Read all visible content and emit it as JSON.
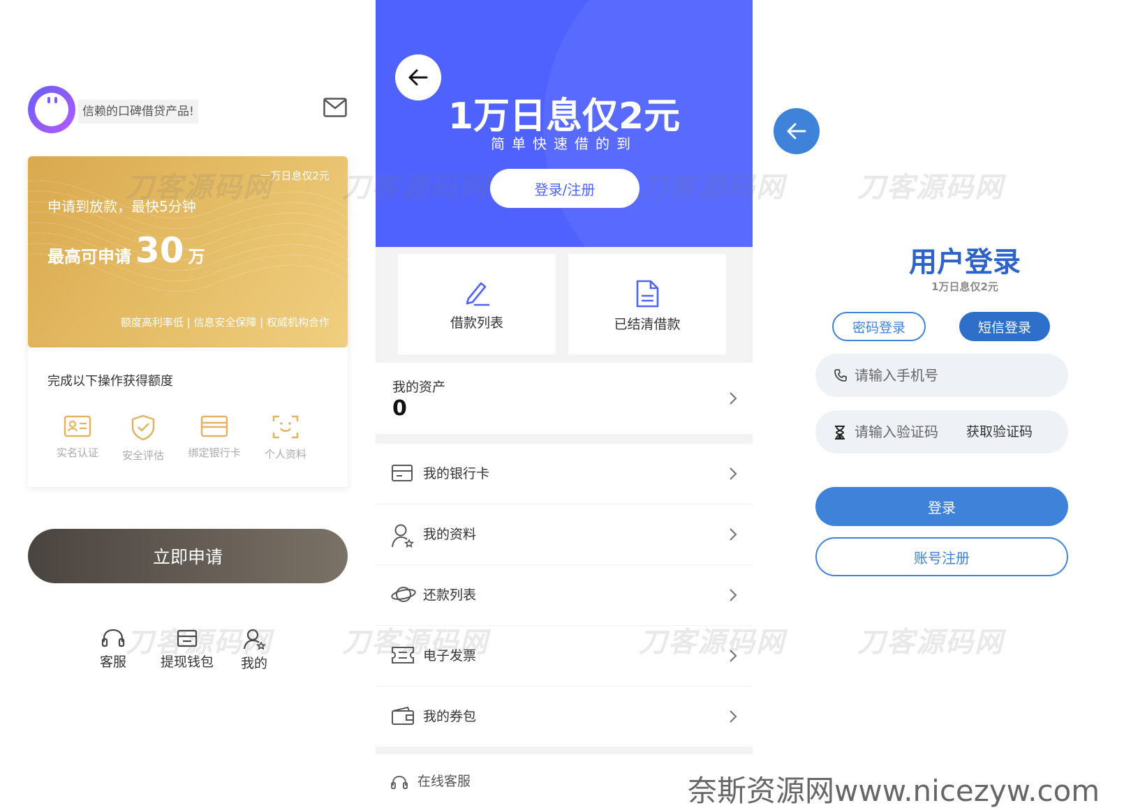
{
  "panel1": {
    "slogan": "信赖的口碑借贷产品!",
    "card": {
      "tag": "一万日息仅2元",
      "line1": "申请到放款，最快5分钟",
      "max_prefix": "最高可申请",
      "max_amount": "30",
      "max_unit": "万",
      "features": "额度高利率低 | 信息安全保障 | 权威机构合作"
    },
    "ops": {
      "title": "完成以下操作获得额度",
      "items": [
        {
          "label": "实名认证",
          "icon": "id-card-icon"
        },
        {
          "label": "安全评估",
          "icon": "shield-check-icon"
        },
        {
          "label": "绑定银行卡",
          "icon": "bank-card-icon"
        },
        {
          "label": "个人资料",
          "icon": "face-scan-icon"
        }
      ]
    },
    "apply_label": "立即申请",
    "nav": [
      {
        "label": "客服",
        "icon": "headset-icon"
      },
      {
        "label": "提现钱包",
        "icon": "wallet-icon"
      },
      {
        "label": "我的",
        "icon": "user-icon"
      }
    ]
  },
  "panel2": {
    "banner_title": "1万日息仅2元",
    "banner_subtitle": "简单快速借的到",
    "login_register": "登录/注册",
    "quick": [
      {
        "label": "借款列表",
        "icon": "edit-icon"
      },
      {
        "label": "已结清借款",
        "icon": "document-icon"
      }
    ],
    "assets_label": "我的资产",
    "assets_value": "0",
    "menu": [
      {
        "label": "我的银行卡",
        "icon": "bank-card-icon"
      },
      {
        "label": "我的资料",
        "icon": "user-star-icon"
      },
      {
        "label": "还款列表",
        "icon": "planet-icon"
      },
      {
        "label": "电子发票",
        "icon": "ticket-icon"
      },
      {
        "label": "我的券包",
        "icon": "wallet-icon"
      }
    ],
    "online_service": "在线客服"
  },
  "panel3": {
    "title": "用户登录",
    "subtitle": "1万日息仅2元",
    "tab_password": "密码登录",
    "tab_sms": "短信登录",
    "phone_placeholder": "请输入手机号",
    "code_placeholder": "请输入验证码",
    "get_code": "获取验证码",
    "login_label": "登录",
    "register_label": "账号注册"
  },
  "watermark": "刀客源码网",
  "site_watermark": "奈斯资源网www.nicezyw.com",
  "colors": {
    "gold": "#e2b860",
    "brand_blue": "#4f62fe",
    "login_blue": "#3f82d9",
    "apply_dark": "#5a534c"
  }
}
